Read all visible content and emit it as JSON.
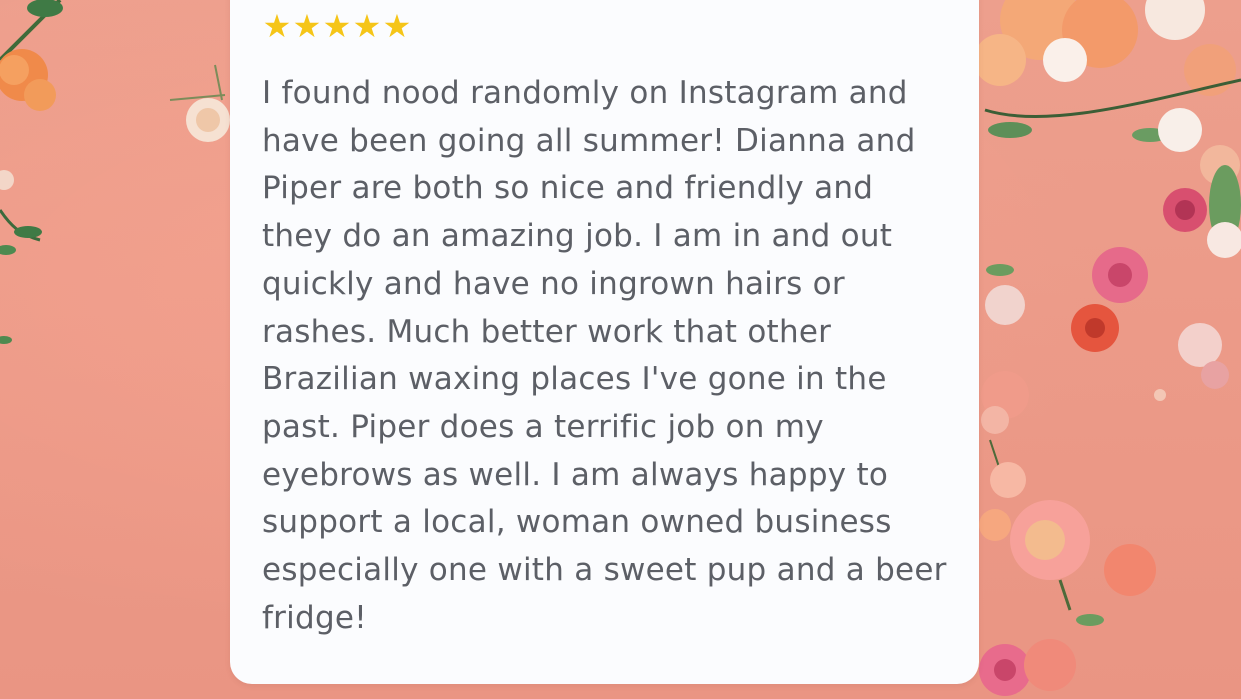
{
  "rating": {
    "stars": [
      "★",
      "★",
      "★",
      "★",
      "★"
    ],
    "value": 5,
    "max": 5,
    "color": "#f5c518"
  },
  "review": {
    "text": "I found nood randomly on Instagram and\nhave been going all summer! Dianna and\nPiper are both so nice and friendly and\nthey do an amazing job. I am in and out\nquickly and have no ingrown hairs or\nrashes. Much better work that other\nBrazilian waxing places I've gone in the\npast. Piper does a terrific job on my\neyebrows as well. I am always happy to\nsupport a local, woman owned business\nespecially one with a sweet pup and a beer\nfridge!"
  },
  "theme": {
    "background": "#ec9a88",
    "card": "#fbfcfe",
    "text": "#5c5f66"
  }
}
